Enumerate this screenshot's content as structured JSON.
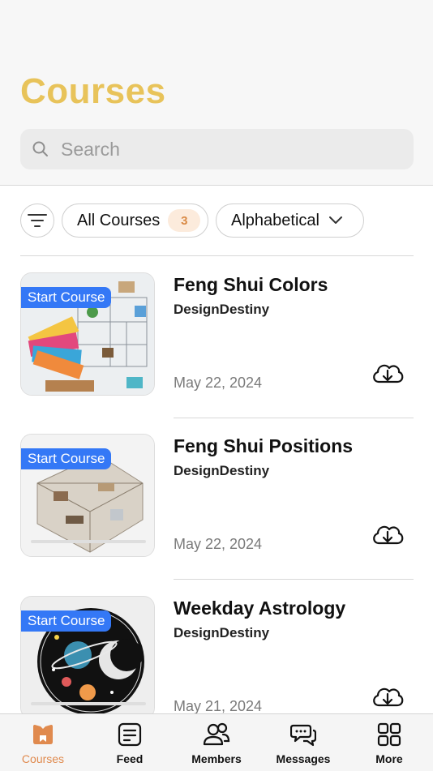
{
  "header": {
    "title": "Courses",
    "search_placeholder": "Search"
  },
  "filters": {
    "all_courses_label": "All Courses",
    "course_count": "3",
    "sort_label": "Alphabetical"
  },
  "courses": [
    {
      "badge": "Start Course",
      "title": "Feng Shui Colors",
      "author": "DesignDestiny",
      "date": "May 22, 2024"
    },
    {
      "badge": "Start Course",
      "title": "Feng Shui Positions",
      "author": "DesignDestiny",
      "date": "May 22, 2024"
    },
    {
      "badge": "Start Course",
      "title": "Weekday Astrology",
      "author": "DesignDestiny",
      "date": "May 21, 2024"
    }
  ],
  "tabbar": {
    "items": [
      {
        "label": "Courses",
        "icon": "courses-icon",
        "active": true
      },
      {
        "label": "Feed",
        "icon": "feed-icon",
        "active": false
      },
      {
        "label": "Members",
        "icon": "members-icon",
        "active": false
      },
      {
        "label": "Messages",
        "icon": "messages-icon",
        "active": false
      },
      {
        "label": "More",
        "icon": "grid-icon",
        "active": false
      }
    ]
  },
  "colors": {
    "title": "#e8c35a",
    "badge": "#3478f6",
    "active_tab": "#e08a4e",
    "count_badge_bg": "#fcebdc",
    "count_badge_text": "#d98a45"
  }
}
